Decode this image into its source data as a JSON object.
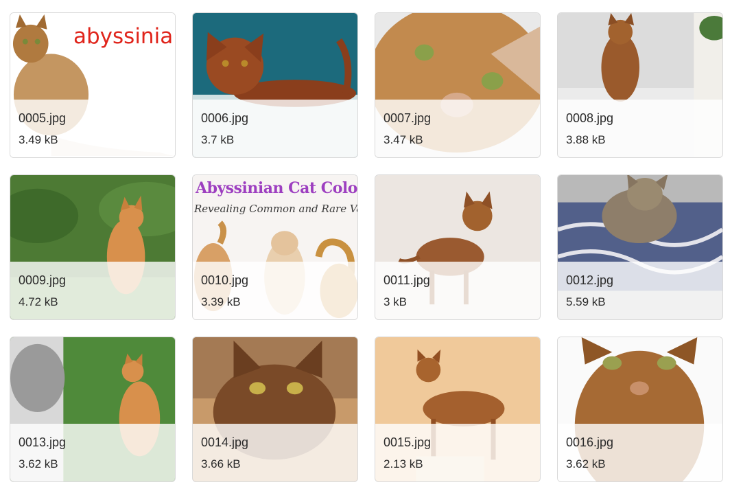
{
  "gallery": {
    "items": [
      {
        "file_name": "0005.jpg",
        "file_size": "3.49 kB",
        "label": "abyssinian"
      },
      {
        "file_name": "0006.jpg",
        "file_size": "3.7 kB"
      },
      {
        "file_name": "0007.jpg",
        "file_size": "3.47 kB"
      },
      {
        "file_name": "0008.jpg",
        "file_size": "3.88 kB"
      },
      {
        "file_name": "0009.jpg",
        "file_size": "4.72 kB"
      },
      {
        "file_name": "0010.jpg",
        "file_size": "3.39 kB",
        "banner_title": "Abyssinian Cat Colors",
        "banner_subtitle": "Revealing Common and Rare Varieties"
      },
      {
        "file_name": "0011.jpg",
        "file_size": "3 kB"
      },
      {
        "file_name": "0012.jpg",
        "file_size": "5.59 kB"
      },
      {
        "file_name": "0013.jpg",
        "file_size": "3.62 kB"
      },
      {
        "file_name": "0014.jpg",
        "file_size": "3.66 kB"
      },
      {
        "file_name": "0015.jpg",
        "file_size": "2.13 kB"
      },
      {
        "file_name": "0016.jpg",
        "file_size": "3.62 kB"
      }
    ]
  },
  "colors": {
    "label_red": "#e0241b",
    "card_border": "#d9d9d9",
    "banner_purple": "#9d3fc0"
  }
}
